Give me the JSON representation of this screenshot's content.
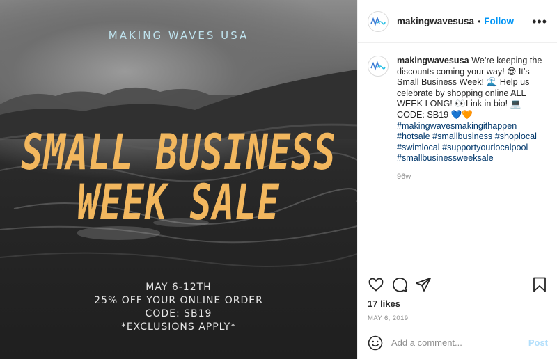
{
  "image": {
    "brand": "MAKING WAVES USA",
    "headline_line1": "SMALL BUSINESS",
    "headline_line2": "WEEK SALE",
    "details": [
      "MAY 6-12TH",
      "25% OFF YOUR ONLINE ORDER",
      "CODE: SB19",
      "*EXCLUSIONS APPLY*"
    ]
  },
  "header": {
    "username": "makingwavesusa",
    "separator": "•",
    "follow_label": "Follow",
    "more_icon": "more-horizontal-icon"
  },
  "caption": {
    "username": "makingwavesusa",
    "text": "We’re keeping the discounts coming your way! 😎 It’s Small Business Week! 🌊 Help us celebrate by shopping online ALL WEEK LONG! 👀Link in bio! 💻CODE: SB19 💙🧡",
    "hashtags": [
      "#makingwavesmakingithappen",
      "#hotsale",
      "#smallbusiness",
      "#shoplocal",
      "#swimlocal",
      "#supportyourlocalpool",
      "#smallbusinessweeksale"
    ],
    "time_ago": "96w"
  },
  "actions": {
    "like_icon": "heart-icon",
    "comment_icon": "comment-icon",
    "share_icon": "paper-plane-icon",
    "save_icon": "bookmark-icon",
    "likes": "17 likes",
    "date": "MAY 6, 2019"
  },
  "comment": {
    "emoji_icon": "smiley-icon",
    "placeholder": "Add a comment...",
    "post_label": "Post"
  },
  "colors": {
    "headline": "#f2b75e",
    "brand": "#bfe3ee",
    "follow": "#0095f6",
    "hashtag": "#00376b",
    "post_disabled": "#b2dffc"
  }
}
